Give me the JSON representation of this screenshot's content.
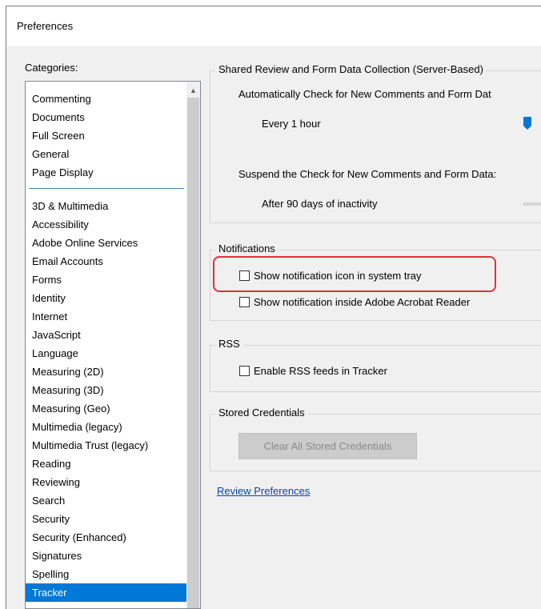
{
  "window": {
    "title": "Preferences"
  },
  "categories": {
    "label": "Categories:",
    "pinned_items": [
      "Commenting",
      "Documents",
      "Full Screen",
      "General",
      "Page Display"
    ],
    "items": [
      "3D & Multimedia",
      "Accessibility",
      "Adobe Online Services",
      "Email Accounts",
      "Forms",
      "Identity",
      "Internet",
      "JavaScript",
      "Language",
      "Measuring (2D)",
      "Measuring (3D)",
      "Measuring (Geo)",
      "Multimedia (legacy)",
      "Multimedia Trust (legacy)",
      "Reading",
      "Reviewing",
      "Search",
      "Security",
      "Security (Enhanced)",
      "Signatures",
      "Spelling",
      "Tracker"
    ],
    "selected": "Tracker"
  },
  "shared_review": {
    "title": "Shared Review and Form Data Collection (Server-Based)",
    "auto_check_label": "Automatically Check for New Comments and Form Dat",
    "auto_check_value": "Every 1 hour",
    "suspend_label": "Suspend the Check for New Comments and Form Data:",
    "suspend_value": "After 90 days of inactivity"
  },
  "notifications": {
    "title": "Notifications",
    "system_tray_label": "Show notification icon in system tray",
    "system_tray_checked": false,
    "inside_reader_label": "Show notification inside Adobe Acrobat Reader",
    "inside_reader_checked": false
  },
  "rss": {
    "title": "RSS",
    "enable_label": "Enable RSS feeds in Tracker",
    "enable_checked": false
  },
  "stored_credentials": {
    "title": "Stored Credentials",
    "clear_button": "Clear All Stored Credentials"
  },
  "review_preferences_link": "Review Preferences",
  "colors": {
    "accent": "#0078d7",
    "highlight_border": "#e0303a",
    "link": "#0645ad"
  }
}
